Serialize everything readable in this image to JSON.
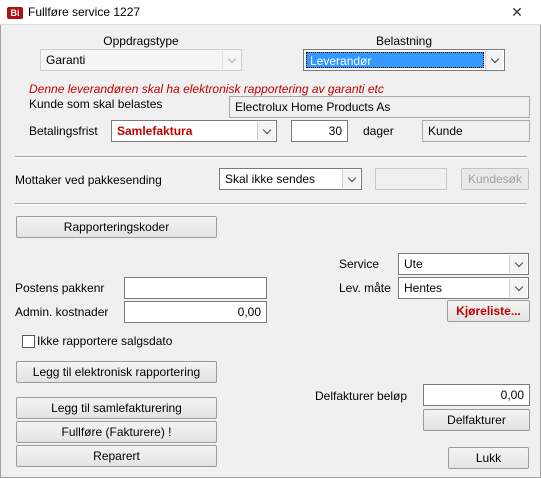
{
  "window": {
    "title": "Fullføre service 1227"
  },
  "assignment_type": {
    "label": "Oppdragstype",
    "value": "Garanti"
  },
  "charge": {
    "label": "Belastning",
    "value": "Leverandør"
  },
  "warning": "Denne leverandøren skal ha elektronisk rapportering av garanti etc",
  "customer": {
    "label": "Kunde som skal belastes",
    "value": "Electrolux Home Products As"
  },
  "payment": {
    "label": "Betalingsfrist",
    "value": "Samlefaktura",
    "days": "30",
    "days_label": "dager",
    "customer_field": "Kunde"
  },
  "recipient": {
    "label": "Mottaker ved pakkesending",
    "value": "Skal ikke sendes",
    "input_value": "",
    "search_button": "Kundesøk"
  },
  "reporting_codes_button": "Rapporteringskoder",
  "service": {
    "label": "Service",
    "value": "Ute"
  },
  "delivery": {
    "label": "Lev. måte",
    "value": "Hentes",
    "list_button": "Kjøreliste..."
  },
  "postal_pack": {
    "label": "Postens pakkenr",
    "value": ""
  },
  "admin_cost": {
    "label": "Admin. kostnader",
    "value": "0,00"
  },
  "skip_sales_date": {
    "label": "Ikke rapportere salgsdato",
    "checked": false
  },
  "add_electronic_button": "Legg til elektronisk rapportering",
  "partial_invoice": {
    "label": "Delfakturer beløp",
    "value": "0,00",
    "button": "Delfakturer"
  },
  "add_collective_button": "Legg til samlefakturering",
  "complete_button": "Fullføre (Fakturere) !",
  "repair_button": "Reparert",
  "close_button": "Lukk",
  "colors": {
    "warning": "#c00000",
    "selection": "#3399ff"
  }
}
